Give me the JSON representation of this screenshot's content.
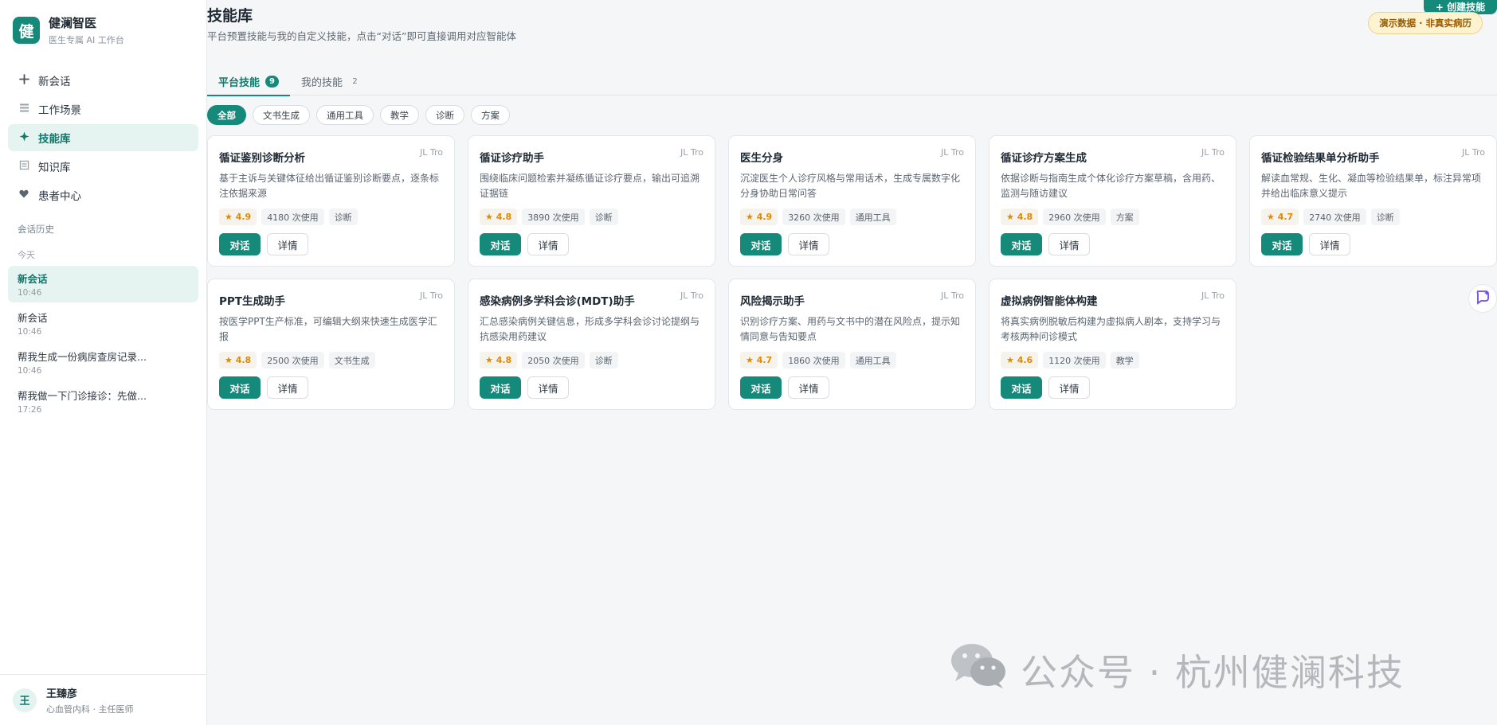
{
  "brand": {
    "logo_char": "健",
    "name": "健澜智医",
    "subtitle": "医生专属 AI 工作台"
  },
  "nav": [
    {
      "label": "新会话",
      "icon": "plus-icon"
    },
    {
      "label": "工作场景",
      "icon": "grid-icon"
    },
    {
      "label": "技能库",
      "icon": "sparkle-icon",
      "active": true
    },
    {
      "label": "知识库",
      "icon": "book-icon"
    },
    {
      "label": "患者中心",
      "icon": "heart-icon"
    }
  ],
  "history": {
    "title": "会话历史",
    "group": "今天",
    "items": [
      {
        "title": "新会话",
        "time": "10:46",
        "active": true
      },
      {
        "title": "新会话",
        "time": "10:46"
      },
      {
        "title": "帮我生成一份病房查房记录...",
        "time": "10:46"
      },
      {
        "title": "帮我做一下门诊接诊：先做...",
        "time": "17:26"
      }
    ]
  },
  "user": {
    "avatar_char": "王",
    "name": "王臻彦",
    "role": "心血管内科 · 主任医师"
  },
  "page": {
    "title": "技能库",
    "description": "平台预置技能与我的自定义技能，点击“对话”即可直接调用对应智能体",
    "top_button": "+ 创建技能",
    "demo_badge": "演示数据 · 非真实病历"
  },
  "tabs": [
    {
      "label": "平台技能",
      "count": "9",
      "active": true
    },
    {
      "label": "我的技能",
      "count": "2"
    }
  ],
  "filters": [
    "全部",
    "文书生成",
    "通用工具",
    "教学",
    "诊断",
    "方案"
  ],
  "labels": {
    "chat": "对话",
    "detail": "详情"
  },
  "skills": [
    {
      "title": "循证鉴别诊断分析",
      "author": "JL Tro",
      "desc": "基于主诉与关键体征给出循证鉴别诊断要点，逐条标注依据来源",
      "rating": "★ 4.9",
      "uses": "4180 次使用",
      "tag": "诊断"
    },
    {
      "title": "循证诊疗助手",
      "author": "JL Tro",
      "desc": "围绕临床问题检索并凝练循证诊疗要点，输出可追溯证据链",
      "rating": "★ 4.8",
      "uses": "3890 次使用",
      "tag": "诊断"
    },
    {
      "title": "医生分身",
      "author": "JL Tro",
      "desc": "沉淀医生个人诊疗风格与常用话术，生成专属数字化分身协助日常问答",
      "rating": "★ 4.9",
      "uses": "3260 次使用",
      "tag": "通用工具"
    },
    {
      "title": "循证诊疗方案生成",
      "author": "JL Tro",
      "desc": "依据诊断与指南生成个体化诊疗方案草稿，含用药、监测与随访建议",
      "rating": "★ 4.8",
      "uses": "2960 次使用",
      "tag": "方案"
    },
    {
      "title": "循证检验结果单分析助手",
      "author": "JL Tro",
      "desc": "解读血常规、生化、凝血等检验结果单，标注异常项并给出临床意义提示",
      "rating": "★ 4.7",
      "uses": "2740 次使用",
      "tag": "诊断"
    },
    {
      "title": "PPT生成助手",
      "author": "JL Tro",
      "desc": "按医学PPT生产标准，可编辑大纲来快速生成医学汇报",
      "rating": "★ 4.8",
      "uses": "2500 次使用",
      "tag": "文书生成"
    },
    {
      "title": "感染病例多学科会诊(MDT)助手",
      "author": "JL Tro",
      "desc": "汇总感染病例关键信息，形成多学科会诊讨论提纲与抗感染用药建议",
      "rating": "★ 4.8",
      "uses": "2050 次使用",
      "tag": "诊断"
    },
    {
      "title": "风险揭示助手",
      "author": "JL Tro",
      "desc": "识别诊疗方案、用药与文书中的潜在风险点，提示知情同意与告知要点",
      "rating": "★ 4.7",
      "uses": "1860 次使用",
      "tag": "通用工具"
    },
    {
      "title": "虚拟病例智能体构建",
      "author": "JL Tro",
      "desc": "将真实病例脱敏后构建为虚拟病人剧本，支持学习与考核两种问诊模式",
      "rating": "★ 4.6",
      "uses": "1120 次使用",
      "tag": "教学"
    }
  ],
  "watermark": "公众号 · 杭州健澜科技",
  "colors": {
    "primary": "#15897a",
    "badge_bg": "#fdf3d0",
    "rating": "#e08a00"
  }
}
